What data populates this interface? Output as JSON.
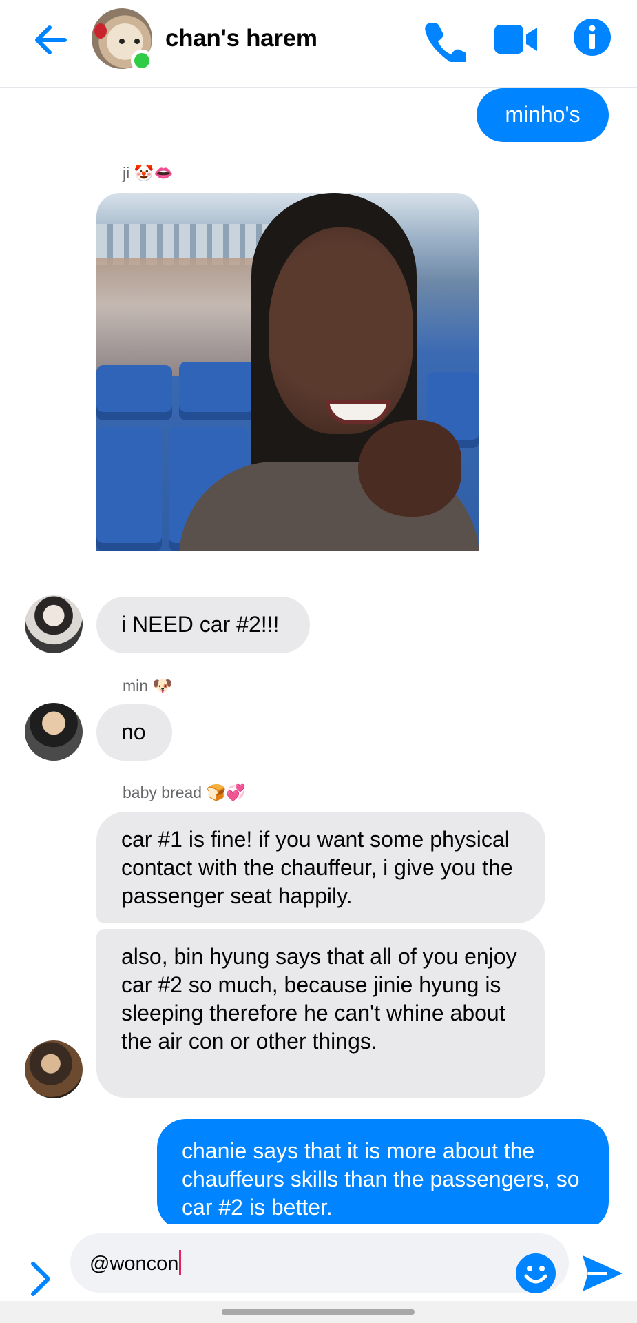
{
  "header": {
    "title": "chan's harem",
    "back_icon": "back-arrow-icon",
    "call_icon": "phone-icon",
    "video_icon": "video-camera-icon",
    "info_icon": "info-icon",
    "online": true,
    "accent_color": "#0084ff"
  },
  "messages": [
    {
      "direction": "out",
      "text": "minho's"
    },
    {
      "direction": "in",
      "sender": "ji 🤡👄",
      "type": "image"
    },
    {
      "direction": "in",
      "text": "i NEED car #2!!!"
    },
    {
      "direction": "in",
      "sender": "min 🐶",
      "text": "no"
    },
    {
      "direction": "in",
      "sender": "baby bread 🍞💞",
      "text": "car #1 is fine! if you want some physical contact with the chauffeur, i give you the passenger seat happily."
    },
    {
      "direction": "in",
      "text": "also, bin hyung says that all of you enjoy car #2 so much, because jinie hyung is sleeping therefore he can't whine about the air con or other things."
    },
    {
      "direction": "out",
      "text": "chanie says that it is more about the chauffeurs skills than the passengers, so car #2 is better."
    }
  ],
  "composer": {
    "value": "@woncon",
    "expand_icon": "chevron-right-icon",
    "emoji_icon": "smiley-icon",
    "send_icon": "send-icon"
  }
}
